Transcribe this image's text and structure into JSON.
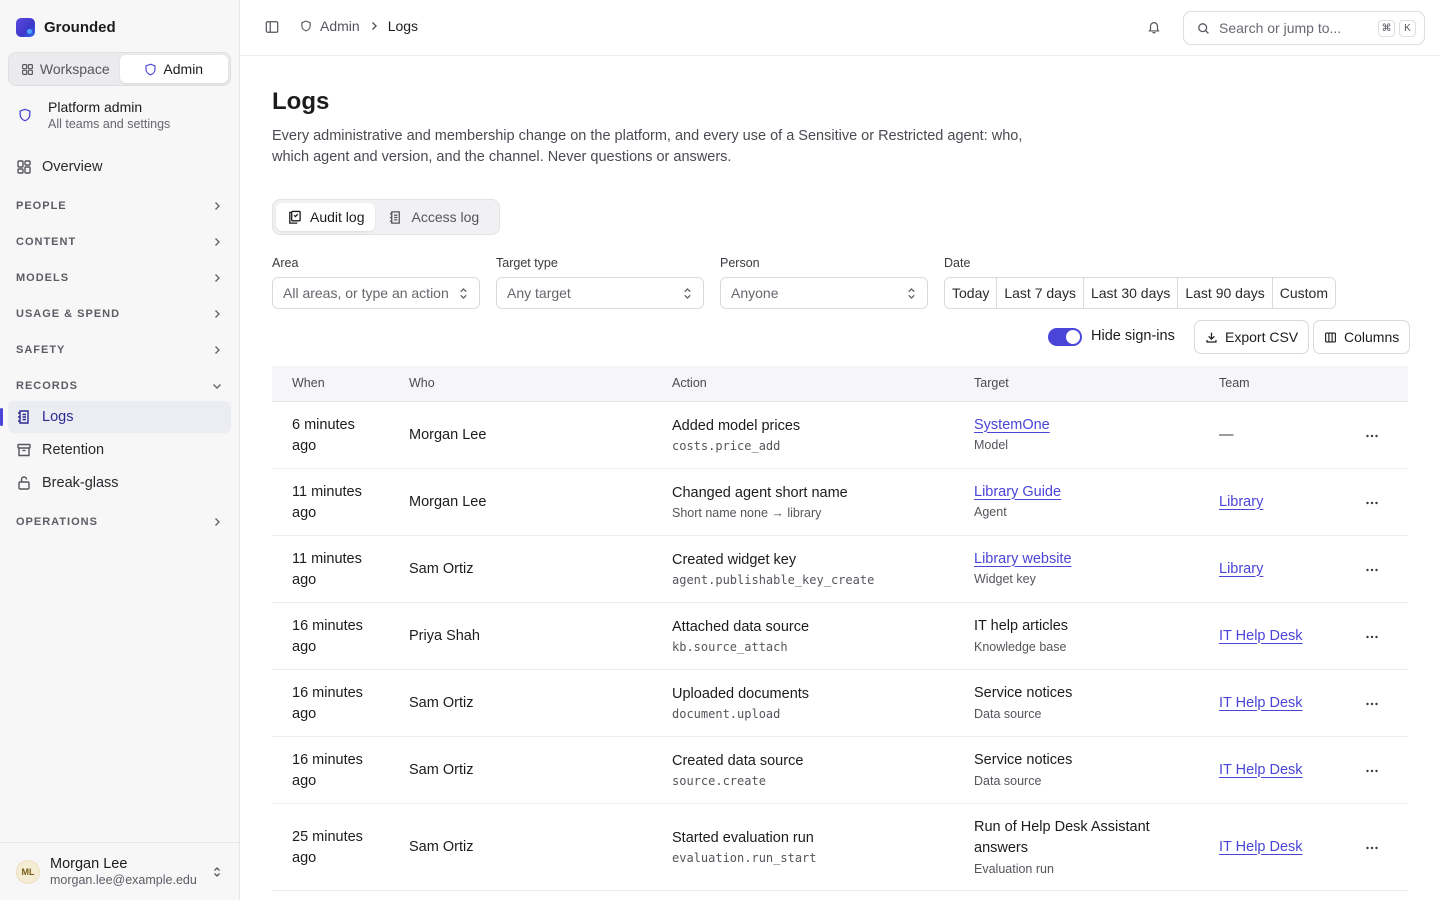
{
  "app": {
    "name": "Grounded"
  },
  "mode_switch": {
    "workspace": "Workspace",
    "admin": "Admin"
  },
  "scope": {
    "title": "Platform admin",
    "subtitle": "All teams and settings"
  },
  "nav": {
    "overview": "Overview",
    "sections": {
      "people": "PEOPLE",
      "content": "CONTENT",
      "models": "MODELS",
      "usage": "USAGE & SPEND",
      "safety": "SAFETY",
      "records": "RECORDS",
      "operations": "OPERATIONS"
    },
    "records_items": {
      "logs": "Logs",
      "retention": "Retention",
      "breakglass": "Break-glass"
    }
  },
  "user": {
    "initials": "ML",
    "name": "Morgan Lee",
    "email": "morgan.lee@example.edu"
  },
  "breadcrumb": {
    "parent": "Admin",
    "current": "Logs"
  },
  "search": {
    "placeholder": "Search or jump to...",
    "kbd1": "⌘",
    "kbd2": "K"
  },
  "page": {
    "title": "Logs",
    "description": "Every administrative and membership change on the platform, and every use of a Sensitive or Restricted agent: who, which agent and version, and the channel. Never questions or answers."
  },
  "tabs": {
    "audit": "Audit log",
    "access": "Access log"
  },
  "filters": {
    "area": {
      "label": "Area",
      "value": "All areas, or type an action"
    },
    "target_type": {
      "label": "Target type",
      "value": "Any target"
    },
    "person": {
      "label": "Person",
      "value": "Anyone"
    },
    "date": {
      "label": "Date",
      "options": [
        "Today",
        "Last 7 days",
        "Last 30 days",
        "Last 90 days",
        "Custom"
      ]
    }
  },
  "controls": {
    "hide_signins": "Hide sign-ins",
    "hide_signins_on": true,
    "export": "Export CSV",
    "columns": "Columns"
  },
  "table": {
    "headers": {
      "when": "When",
      "who": "Who",
      "action": "Action",
      "target": "Target",
      "team": "Team"
    },
    "rows": [
      {
        "when": "6 minutes ago",
        "who": "Morgan Lee",
        "action": "Added model prices",
        "action_sub": "costs.price_add",
        "action_sub_mono": true,
        "target": "SystemOne",
        "target_link": true,
        "target_sub": "Model",
        "team": "—",
        "team_link": false
      },
      {
        "when": "11 minutes ago",
        "who": "Morgan Lee",
        "action": "Changed agent short name",
        "action_sub": "Short name none → library",
        "action_sub_mono": false,
        "target": "Library Guide",
        "target_link": true,
        "target_sub": "Agent",
        "team": "Library",
        "team_link": true
      },
      {
        "when": "11 minutes ago",
        "who": "Sam Ortiz",
        "action": "Created widget key",
        "action_sub": "agent.publishable_key_create",
        "action_sub_mono": true,
        "target": "Library website",
        "target_link": true,
        "target_sub": "Widget key",
        "team": "Library",
        "team_link": true
      },
      {
        "when": "16 minutes ago",
        "who": "Priya Shah",
        "action": "Attached data source",
        "action_sub": "kb.source_attach",
        "action_sub_mono": true,
        "target": "IT help articles",
        "target_link": false,
        "target_sub": "Knowledge base",
        "team": "IT Help Desk",
        "team_link": true
      },
      {
        "when": "16 minutes ago",
        "who": "Sam Ortiz",
        "action": "Uploaded documents",
        "action_sub": "document.upload",
        "action_sub_mono": true,
        "target": "Service notices",
        "target_link": false,
        "target_sub": "Data source",
        "team": "IT Help Desk",
        "team_link": true
      },
      {
        "when": "16 minutes ago",
        "who": "Sam Ortiz",
        "action": "Created data source",
        "action_sub": "source.create",
        "action_sub_mono": true,
        "target": "Service notices",
        "target_link": false,
        "target_sub": "Data source",
        "team": "IT Help Desk",
        "team_link": true
      },
      {
        "when": "25 minutes ago",
        "who": "Sam Ortiz",
        "action": "Started evaluation run",
        "action_sub": "evaluation.run_start",
        "action_sub_mono": true,
        "target": "Run of Help Desk Assistant answers",
        "target_link": false,
        "target_sub": "Evaluation run",
        "team": "IT Help Desk",
        "team_link": true
      }
    ]
  },
  "colors": {
    "accent": "#4a44d8",
    "sidebar_bg": "#f7f7f8",
    "table_header_bg": "#f6f6f8"
  }
}
